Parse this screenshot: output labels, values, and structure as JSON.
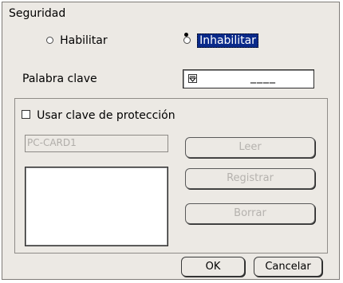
{
  "dialog": {
    "title": "Seguridad"
  },
  "mode": {
    "enable_label": "Habilitar",
    "disable_label": "Inhabilitar",
    "selected": "Inhabilitar"
  },
  "password": {
    "label": "Palabra clave",
    "value": "____"
  },
  "protect_key": {
    "checkbox_label": "Usar clave de protección",
    "checked": false,
    "device_value": "PC-CARD1"
  },
  "buttons": {
    "read": "Leer",
    "register": "Registrar",
    "delete": "Borrar",
    "ok": "OK",
    "cancel": "Cancelar"
  }
}
